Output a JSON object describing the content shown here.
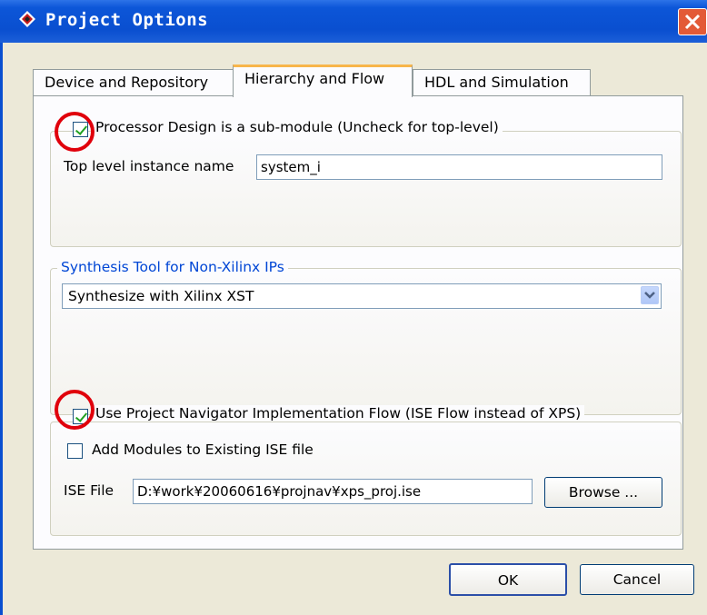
{
  "window": {
    "title": "Project Options"
  },
  "tabs": [
    {
      "label": "Device and Repository"
    },
    {
      "label": "Hierarchy and Flow"
    },
    {
      "label": "HDL and Simulation"
    }
  ],
  "hierarchy": {
    "submodule_checkbox_label": "Processor Design is a sub-module (Uncheck for top-level)",
    "submodule_checked": true,
    "instance_label": "Top level instance name",
    "instance_value": "system_i"
  },
  "synthesis": {
    "group_label": "Synthesis Tool for Non-Xilinx IPs",
    "selected": "Synthesize with Xilinx XST"
  },
  "flow": {
    "ise_flow_label": "Use Project Navigator Implementation Flow (ISE Flow instead of XPS)",
    "ise_flow_checked": true,
    "add_modules_label": "Add Modules to Existing ISE file",
    "add_modules_checked": false,
    "ise_file_label": "ISE File",
    "ise_file_value": "D:¥work¥20060616¥projnav¥xps_proj.ise",
    "browse_label": "Browse ..."
  },
  "buttons": {
    "ok": "OK",
    "cancel": "Cancel"
  },
  "colors": {
    "title_bar": "#0a4fd0",
    "annotation_circle": "#e0000b",
    "group_legend_blue": "#0046d5"
  }
}
